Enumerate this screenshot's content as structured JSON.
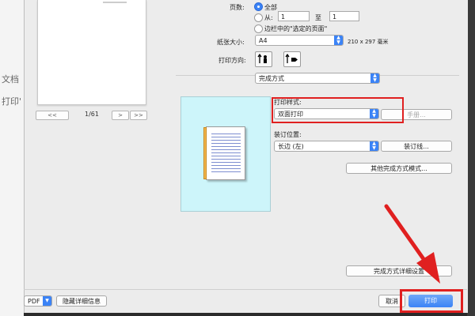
{
  "background_doc": {
    "fragments": [
      "文档",
      "打印'"
    ]
  },
  "preview": {
    "page_indicator": "1/61",
    "first_label": "<<",
    "prev_label": "<",
    "next_label": ">",
    "last_label": ">>"
  },
  "pages": {
    "label": "页数:",
    "all_label": "全部",
    "from_label": "从:",
    "from_value": "1",
    "to_label": "至",
    "to_value": "1",
    "selection_label": "边栏中的\"选定的页面\""
  },
  "paper": {
    "label": "纸张大小:",
    "value": "A4",
    "dimensions": "210 x 297 毫米"
  },
  "orientation": {
    "label": "打印方向:"
  },
  "section": {
    "value": "完成方式"
  },
  "print_style": {
    "label": "打印样式:",
    "value": "双面打印",
    "manual_button": "手册..."
  },
  "binding": {
    "label": "装订位置:",
    "value": "长边 (左)",
    "binding_line_button": "装订线..."
  },
  "other_finishing_button": "其他完成方式模式...",
  "finishing_details_button": "完成方式详细设置",
  "footer": {
    "pdf_label": "PDF",
    "hide_details": "隐藏详细信息",
    "cancel": "取消",
    "print": "打印"
  },
  "colors": {
    "accent": "#3b83f6",
    "highlight": "#e02020",
    "preview_bg": "#cdf5fa"
  }
}
